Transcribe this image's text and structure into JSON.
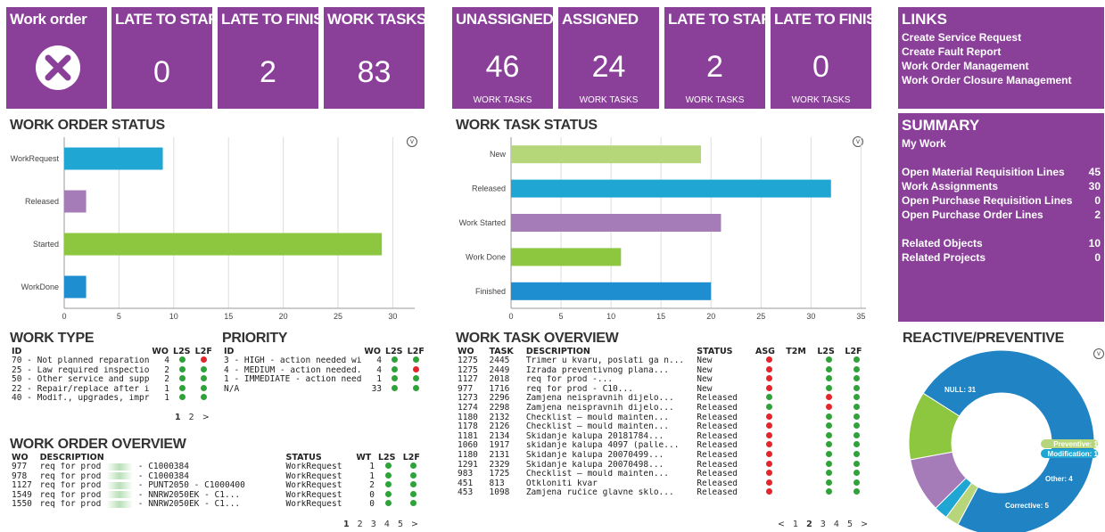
{
  "tiles_left": [
    {
      "title": "Work order",
      "icon": "close-circle-icon"
    },
    {
      "title": "LATE TO START",
      "value": "0"
    },
    {
      "title": "LATE TO FINISH",
      "value": "2"
    },
    {
      "title": "WORK TASKS",
      "value": "83"
    }
  ],
  "tiles_mid": [
    {
      "title": "UNASSIGNED",
      "value": "46",
      "sub": "WORK TASKS"
    },
    {
      "title": "ASSIGNED",
      "value": "24",
      "sub": "WORK TASKS"
    },
    {
      "title": "LATE TO START",
      "value": "2",
      "sub": "WORK TASKS"
    },
    {
      "title": "LATE TO FINISH",
      "value": "0",
      "sub": "WORK TASKS"
    }
  ],
  "links": {
    "title": "LINKS",
    "items": [
      "Create Service Request",
      "Create Fault Report",
      "Work Order Management",
      "Work Order Closure Management"
    ]
  },
  "summary": {
    "title": "SUMMARY",
    "subtitle": "My Work",
    "rows": [
      {
        "label": "Open Material Requisition Lines",
        "value": "45"
      },
      {
        "label": "Work Assignments",
        "value": "30"
      },
      {
        "label": "Open Purchase Requisition Lines",
        "value": "0"
      },
      {
        "label": "Open Purchase Order Lines",
        "value": "2"
      },
      {
        "label": "Related Objects",
        "value": "10"
      },
      {
        "label": "Related Projects",
        "value": "0"
      }
    ]
  },
  "sections": {
    "work_order_status": "WORK ORDER STATUS",
    "work_task_status": "WORK TASK STATUS",
    "work_type": "WORK TYPE",
    "priority": "PRIORITY",
    "work_order_overview": "WORK ORDER OVERVIEW",
    "work_task_overview": "WORK TASK OVERVIEW",
    "reactive_preventive": "REACTIVE/PREVENTIVE"
  },
  "chart_data": [
    {
      "type": "bar",
      "orientation": "horizontal",
      "title": "WORK ORDER STATUS",
      "categories": [
        "WorkRequest",
        "Released",
        "Started",
        "WorkDone"
      ],
      "values": [
        9,
        2,
        29,
        2
      ],
      "colors": [
        "#1fa6d3",
        "#a57bb8",
        "#8dc63f",
        "#1f8ed0"
      ],
      "xlim": [
        0,
        32
      ],
      "xticks": [
        "0",
        "5",
        "10",
        "15",
        "20",
        "25",
        "30"
      ],
      "grid": true
    },
    {
      "type": "bar",
      "orientation": "horizontal",
      "title": "WORK TASK STATUS",
      "categories": [
        "New",
        "Released",
        "Work Started",
        "Work Done",
        "Finished"
      ],
      "values": [
        19,
        32,
        21,
        11,
        20
      ],
      "colors": [
        "#b5d77a",
        "#1fa6d3",
        "#a57bb8",
        "#8dc63f",
        "#1f8ed0"
      ],
      "xlim": [
        0,
        35.5
      ],
      "xticks": [
        "0",
        "5",
        "10",
        "15",
        "20",
        "25",
        "30",
        "35"
      ],
      "grid": true
    },
    {
      "type": "pie",
      "style": "donut",
      "title": "REACTIVE/PREVENTIVE",
      "labels": [
        "NULL",
        "Preventive",
        "Modification",
        "Other",
        "Corrective"
      ],
      "values": [
        31,
        1,
        1,
        4,
        5
      ],
      "slice_labels": [
        "NULL: 31",
        "Preventive: 1",
        "Modification: 1",
        "Other: 4",
        "Corrective: 5"
      ],
      "colors": [
        "#1f83c4",
        "#b7d67c",
        "#1fa6d3",
        "#a57bb8",
        "#8dc63f"
      ]
    }
  ],
  "work_type": {
    "headers": [
      "ID",
      "WO",
      "L2S",
      "L2F"
    ],
    "rows": [
      {
        "id": "70 - Not planned reparations...",
        "wo": "4",
        "l2s": "g",
        "l2f": "r"
      },
      {
        "id": "25 - Law required inspections",
        "wo": "2",
        "l2s": "g",
        "l2f": "g"
      },
      {
        "id": "50 - Other service and supp...",
        "wo": "2",
        "l2s": "g",
        "l2f": "g"
      },
      {
        "id": "22 - Repair/replace after ins...",
        "wo": "1",
        "l2s": "g",
        "l2f": "g"
      },
      {
        "id": "40 - Modif., upgrades, impro...",
        "wo": "1",
        "l2s": "g",
        "l2f": "g"
      }
    ],
    "pager": [
      "1",
      "2",
      ">"
    ]
  },
  "priority": {
    "headers": [
      "ID",
      "WO",
      "L2S",
      "L2F"
    ],
    "rows": [
      {
        "id": "3 - HIGH - action needed wit...",
        "wo": "4",
        "l2s": "g",
        "l2f": "g"
      },
      {
        "id": "4 - MEDIUM - action needed...",
        "wo": "4",
        "l2s": "g",
        "l2f": "r"
      },
      {
        "id": "1 - IMMEDIATE - action need...",
        "wo": "1",
        "l2s": "g",
        "l2f": "g"
      },
      {
        "id": "N/A",
        "wo": "33",
        "l2s": "g",
        "l2f": "g"
      }
    ]
  },
  "work_order_overview": {
    "headers": [
      "WO",
      "DESCRIPTION",
      "STATUS",
      "WT",
      "L2S",
      "L2F"
    ],
    "rows": [
      {
        "wo": "977",
        "desc_a": "req for prod",
        "desc_b": "- C1000384",
        "status": "WorkRequest",
        "wt": "1",
        "l2s": "g",
        "l2f": "g"
      },
      {
        "wo": "978",
        "desc_a": "req for prod",
        "desc_b": "- C1000384",
        "status": "WorkRequest",
        "wt": "1",
        "l2s": "g",
        "l2f": "g"
      },
      {
        "wo": "1127",
        "desc_a": "req for prod",
        "desc_b": "- PUNT2050 - C1000400",
        "status": "WorkRequest",
        "wt": "2",
        "l2s": "g",
        "l2f": "g"
      },
      {
        "wo": "1549",
        "desc_a": "req for prod",
        "desc_b": "- NNRW2050EK - C1...",
        "status": "WorkRequest",
        "wt": "0",
        "l2s": "g",
        "l2f": "g"
      },
      {
        "wo": "1550",
        "desc_a": "req for prod",
        "desc_b": "- NNRW2050EK - C1...",
        "status": "WorkRequest",
        "wt": "0",
        "l2s": "g",
        "l2f": "g"
      }
    ],
    "pager": [
      "1",
      "2",
      "3",
      "4",
      "5",
      ">"
    ]
  },
  "work_task_overview": {
    "headers": [
      "WO",
      "TASK",
      "DESCRIPTION",
      "STATUS",
      "ASG",
      "T2M",
      "L2S",
      "L2F"
    ],
    "rows": [
      {
        "wo": "1275",
        "task": "2445",
        "desc": "Trimer u kvaru, poslati ga n...",
        "status": "New",
        "asg": "r",
        "l2s": "g",
        "l2f": "g"
      },
      {
        "wo": "1275",
        "task": "2449",
        "desc": "Izrada preventivnog plana...",
        "status": "New",
        "asg": "r",
        "l2s": "g",
        "l2f": "g"
      },
      {
        "wo": "1127",
        "task": "2018",
        "desc": "req for prod                 -...",
        "status": "New",
        "asg": "r",
        "l2s": "g",
        "l2f": "g"
      },
      {
        "wo": "977",
        "task": "1716",
        "desc": "req for prod           - C10...",
        "status": "New",
        "asg": "r",
        "l2s": "g",
        "l2f": "g"
      },
      {
        "wo": "1273",
        "task": "2296",
        "desc": "Zamjena neispravnih dijelo...",
        "status": "Released",
        "asg": "g",
        "l2s": "r",
        "l2f": "g"
      },
      {
        "wo": "1274",
        "task": "2298",
        "desc": "Zamjena neispravnih dijelo...",
        "status": "Released",
        "asg": "g",
        "l2s": "r",
        "l2f": "g"
      },
      {
        "wo": "1180",
        "task": "2132",
        "desc": "Checklist – mould mainten...",
        "status": "Released",
        "asg": "r",
        "l2s": "g",
        "l2f": "g"
      },
      {
        "wo": "1178",
        "task": "2126",
        "desc": "Checklist – mould mainten...",
        "status": "Released",
        "asg": "r",
        "l2s": "g",
        "l2f": "g"
      },
      {
        "wo": "1181",
        "task": "2134",
        "desc": "Skidanje kalupa 20181784...",
        "status": "Released",
        "asg": "r",
        "l2s": "g",
        "l2f": "g"
      },
      {
        "wo": "1060",
        "task": "1917",
        "desc": "skidanje kalupa 4097 (palle...",
        "status": "Released",
        "asg": "r",
        "l2s": "g",
        "l2f": "g"
      },
      {
        "wo": "1180",
        "task": "2131",
        "desc": "Skidanje kalupa 20070499...",
        "status": "Released",
        "asg": "r",
        "l2s": "g",
        "l2f": "g"
      },
      {
        "wo": "1291",
        "task": "2329",
        "desc": "Skidanje kalupa 20070498...",
        "status": "Released",
        "asg": "r",
        "l2s": "g",
        "l2f": "g"
      },
      {
        "wo": "983",
        "task": "1725",
        "desc": "Checklist – mould mainten...",
        "status": "Released",
        "asg": "r",
        "l2s": "g",
        "l2f": "g"
      },
      {
        "wo": "451",
        "task": "813",
        "desc": "Otkloniti kvar",
        "status": "Released",
        "asg": "r",
        "l2s": "g",
        "l2f": "g"
      },
      {
        "wo": "453",
        "task": "1098",
        "desc": "Zamjena ručice glavne sklo...",
        "status": "Released",
        "asg": "r",
        "l2s": "g",
        "l2f": "g"
      }
    ],
    "pager": [
      "<",
      "1",
      "2",
      "3",
      "4",
      "5",
      ">"
    ]
  }
}
